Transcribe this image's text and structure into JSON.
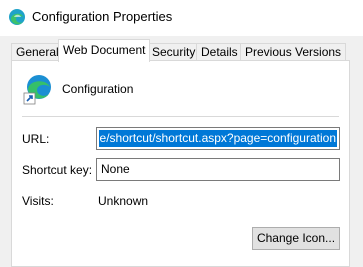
{
  "window": {
    "title": "Configuration Properties"
  },
  "tabs": [
    {
      "label": "General",
      "active": false
    },
    {
      "label": "Web Document",
      "active": true
    },
    {
      "label": "Security",
      "active": false
    },
    {
      "label": "Details",
      "active": false
    },
    {
      "label": "Previous Versions",
      "active": false
    }
  ],
  "shortcut": {
    "name": "Configuration",
    "icon": "edge-shortcut-icon"
  },
  "fields": {
    "url_label": "URL:",
    "url_value": "e/shortcut/shortcut.aspx?page=configuration",
    "shortcut_key_label": "Shortcut key:",
    "shortcut_key_value": "None",
    "visits_label": "Visits:",
    "visits_value": "Unknown"
  },
  "buttons": {
    "change_icon": "Change Icon..."
  },
  "colors": {
    "selection": "#0078d7",
    "tab_border": "#d9d9d9",
    "panel_bg": "#ffffff"
  }
}
